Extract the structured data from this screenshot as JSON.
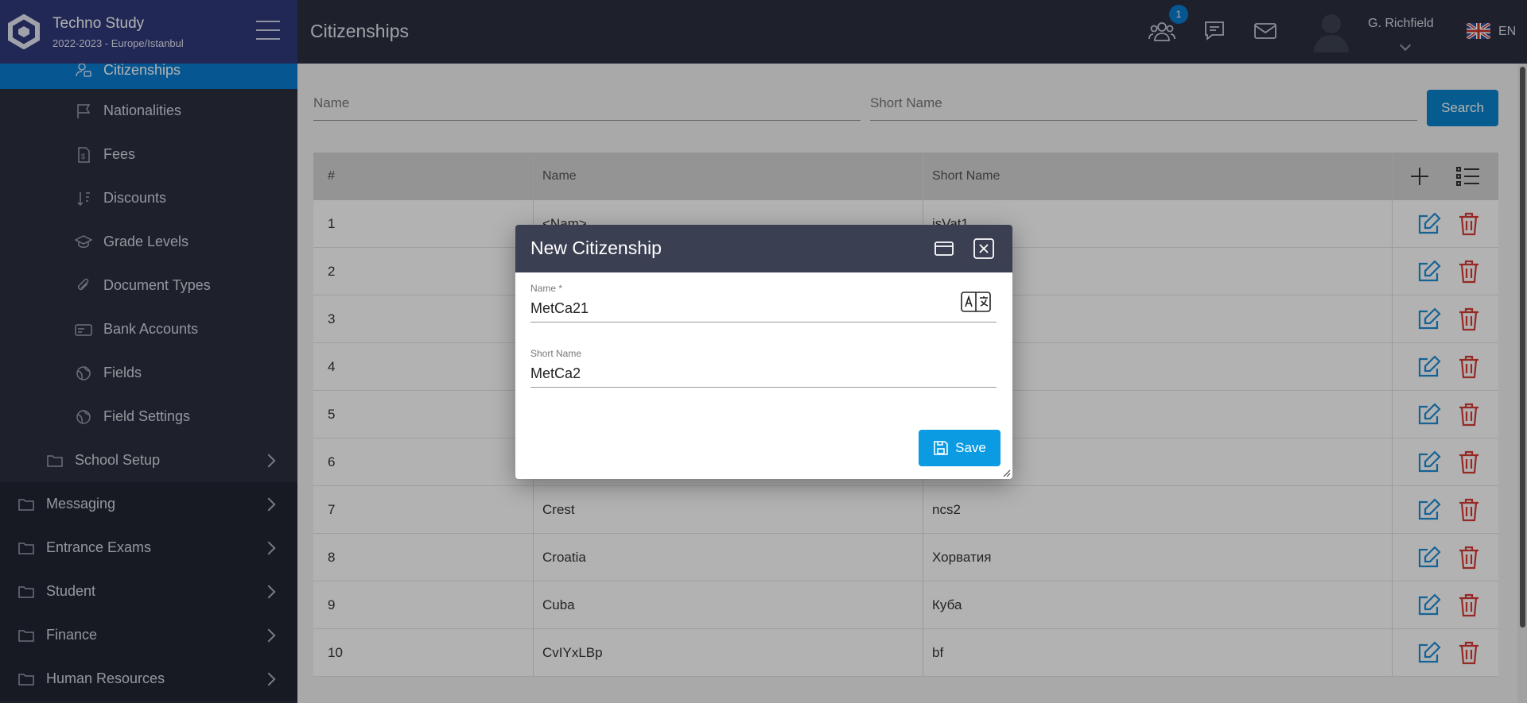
{
  "brand": {
    "name": "Techno Study",
    "subtitle": "2022-2023 - Europe/Istanbul"
  },
  "sidebar": {
    "items": [
      {
        "label": "Citizenships",
        "icon": "citizenship-icon",
        "active": true
      },
      {
        "label": "Nationalities",
        "icon": "flag-icon"
      },
      {
        "label": "Fees",
        "icon": "fees-icon"
      },
      {
        "label": "Discounts",
        "icon": "sort-icon"
      },
      {
        "label": "Grade Levels",
        "icon": "graduation-cap-icon"
      },
      {
        "label": "Document Types",
        "icon": "paperclip-icon"
      },
      {
        "label": "Bank Accounts",
        "icon": "bank-card-icon"
      },
      {
        "label": "Fields",
        "icon": "globe-icon"
      },
      {
        "label": "Field Settings",
        "icon": "globe-icon"
      }
    ],
    "school_setup": "School Setup",
    "top_items": [
      "Messaging",
      "Entrance Exams",
      "Student",
      "Finance",
      "Human Resources"
    ]
  },
  "header": {
    "title": "Citizenships",
    "notification_count": "1",
    "user_name": "G. Richfield",
    "language": "EN"
  },
  "search": {
    "name_placeholder": "Name",
    "short_name_placeholder": "Short Name",
    "button": "Search"
  },
  "table": {
    "columns": [
      "#",
      "Name",
      "Short Name"
    ],
    "rows": [
      [
        "1",
        "<Nam>",
        "isVat1"
      ],
      [
        "2",
        "",
        ""
      ],
      [
        "3",
        "",
        ""
      ],
      [
        "4",
        "",
        ""
      ],
      [
        "5",
        "",
        ""
      ],
      [
        "6",
        "",
        ""
      ],
      [
        "7",
        "Crest",
        "ncs2"
      ],
      [
        "8",
        "Croatia",
        "Хорватия"
      ],
      [
        "9",
        "Cuba",
        "Куба"
      ],
      [
        "10",
        "CvIYxLBp",
        "bf"
      ]
    ]
  },
  "dialog": {
    "title": "New Citizenship",
    "name_label": "Name *",
    "name_value": "MetCa21",
    "short_name_label": "Short Name",
    "short_name_value": "MetCa2",
    "save": "Save"
  },
  "colors": {
    "accent": "#0a7bd0",
    "sidebar": "#2b2f3e",
    "brand_bar": "#323a7a",
    "edit": "#1f8fd6",
    "delete": "#d83a34",
    "dialog_header": "#3a3f52"
  }
}
